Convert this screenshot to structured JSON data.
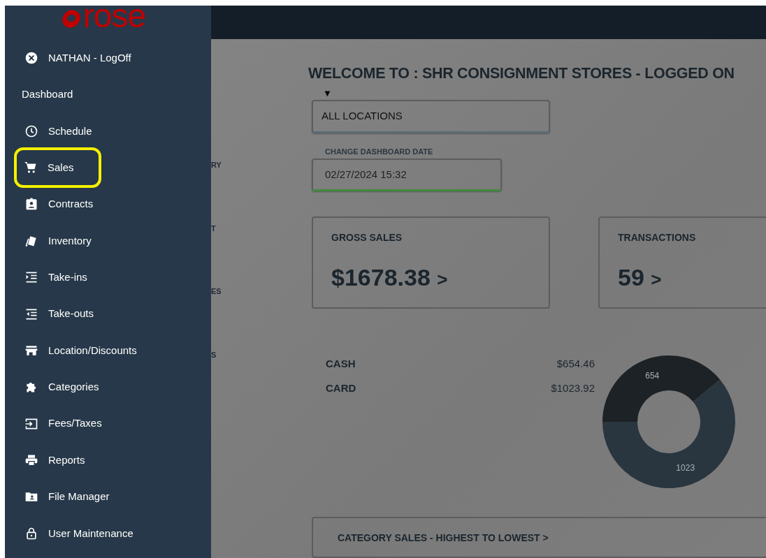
{
  "sidebar": {
    "logo": "rose",
    "items": [
      {
        "label": "NATHAN - LogOff",
        "highlighted": false
      },
      {
        "label": "Dashboard",
        "highlighted": false
      },
      {
        "label": "Schedule",
        "highlighted": false
      },
      {
        "label": "Sales",
        "highlighted": true
      },
      {
        "label": "Contracts",
        "highlighted": false
      },
      {
        "label": "Inventory",
        "highlighted": false
      },
      {
        "label": "Take-ins",
        "highlighted": false
      },
      {
        "label": "Take-outs",
        "highlighted": false
      },
      {
        "label": "Location/Discounts",
        "highlighted": false
      },
      {
        "label": "Categories",
        "highlighted": false
      },
      {
        "label": "Fees/Taxes",
        "highlighted": false
      },
      {
        "label": "Reports",
        "highlighted": false
      },
      {
        "label": "File Manager",
        "highlighted": false
      },
      {
        "label": "User Maintenance",
        "highlighted": false
      }
    ]
  },
  "hidden_menu_fragments": [
    "RY",
    "T",
    "ES",
    "S"
  ],
  "title": "WELCOME TO : SHR CONSIGNMENT STORES - LOGGED ON",
  "location_select": {
    "arrow": "▼",
    "value": "ALL LOCATIONS"
  },
  "date_field": {
    "label": "CHANGE DASHBOARD DATE",
    "value": "02/27/2024 15:32"
  },
  "cards": [
    {
      "label": "GROSS SALES",
      "value": "$1678.38",
      "arrow": ">"
    },
    {
      "label": "TRANSACTIONS",
      "value": "59",
      "arrow": ">"
    }
  ],
  "payments": [
    {
      "label": "CASH",
      "amount": "$654.46"
    },
    {
      "label": "CARD",
      "amount": "$1023.92"
    }
  ],
  "payment_chart": {
    "chart_data": {
      "type": "donut",
      "values": [
        654,
        1023
      ],
      "colors": [
        "#1d2226",
        "#29363f"
      ],
      "data_labels": true
    }
  },
  "category_sales": {
    "title": "CATEGORY SALES - HIGHEST TO LOWEST >"
  }
}
